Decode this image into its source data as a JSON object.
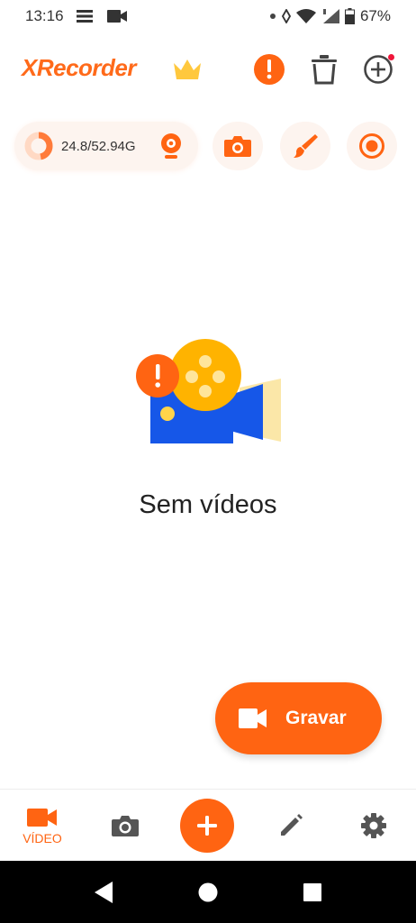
{
  "status_bar": {
    "time": "13:16",
    "battery": "67%",
    "icons": [
      "notification-list-icon",
      "video-icon",
      "dot-icon",
      "wifi-icon",
      "signal-icon",
      "battery-icon"
    ]
  },
  "header": {
    "app_name": "XRecorder",
    "icons": [
      "crown-icon",
      "alert-icon",
      "trash-icon",
      "add-circle-icon"
    ]
  },
  "toolbar": {
    "storage": "24.8/52.94G",
    "storage_used_fraction": 0.468,
    "tools": [
      "webcam-icon",
      "camera-icon",
      "brush-icon",
      "record-icon"
    ]
  },
  "empty_state": {
    "message": "Sem vídeos"
  },
  "fab": {
    "label": "Gravar"
  },
  "bottom_nav": {
    "items": [
      {
        "label": "VÍDEO",
        "icon": "video-icon",
        "active": true
      },
      {
        "label": "",
        "icon": "camera-icon",
        "active": false
      },
      {
        "label": "",
        "icon": "plus-icon",
        "active": false
      },
      {
        "label": "",
        "icon": "pencil-icon",
        "active": false
      },
      {
        "label": "",
        "icon": "gear-icon",
        "active": false
      }
    ]
  },
  "colors": {
    "accent": "#ff6412",
    "logo": "#ff6a1a",
    "crown": "#ffc83d",
    "illustration_blue": "#1657e8",
    "illustration_yellow": "#ffb300"
  }
}
